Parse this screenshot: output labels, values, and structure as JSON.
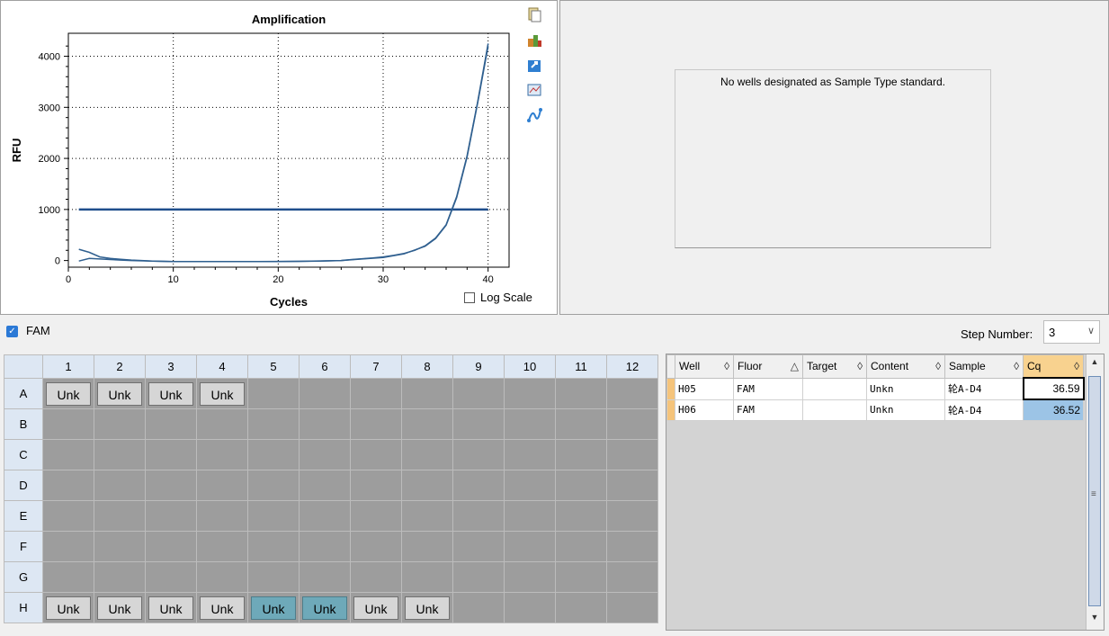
{
  "chart_data": {
    "type": "line",
    "title": "Amplification",
    "xlabel": "Cycles",
    "ylabel": "RFU",
    "xlim": [
      0,
      42
    ],
    "ylim": [
      -130,
      4450
    ],
    "xticks": [
      0,
      10,
      20,
      30,
      40
    ],
    "yticks": [
      0,
      1000,
      2000,
      3000,
      4000
    ],
    "grid": true,
    "threshold": 1000,
    "series": [
      {
        "values": [
          [
            1,
            220
          ],
          [
            2,
            160
          ],
          [
            3,
            70
          ],
          [
            4,
            40
          ],
          [
            5,
            25
          ],
          [
            6,
            10
          ],
          [
            7,
            0
          ],
          [
            8,
            -10
          ],
          [
            9,
            -15
          ],
          [
            10,
            -20
          ],
          [
            12,
            -20
          ],
          [
            14,
            -20
          ],
          [
            16,
            -20
          ],
          [
            18,
            -20
          ],
          [
            20,
            -20
          ],
          [
            22,
            -15
          ],
          [
            24,
            -10
          ],
          [
            26,
            0
          ],
          [
            27,
            20
          ],
          [
            28,
            35
          ],
          [
            29,
            50
          ],
          [
            30,
            70
          ],
          [
            31,
            100
          ],
          [
            32,
            140
          ],
          [
            33,
            200
          ],
          [
            34,
            290
          ],
          [
            35,
            440
          ],
          [
            36,
            700
          ],
          [
            37,
            1250
          ],
          [
            38,
            2050
          ],
          [
            39,
            3100
          ],
          [
            40,
            4250
          ]
        ]
      },
      {
        "values": [
          [
            1,
            -10
          ],
          [
            2,
            40
          ],
          [
            3,
            30
          ],
          [
            4,
            20
          ],
          [
            5,
            10
          ],
          [
            6,
            0
          ],
          [
            8,
            -10
          ],
          [
            10,
            -20
          ],
          [
            14,
            -20
          ],
          [
            18,
            -20
          ],
          [
            22,
            -15
          ],
          [
            26,
            0
          ],
          [
            28,
            30
          ],
          [
            30,
            60
          ],
          [
            32,
            130
          ],
          [
            34,
            280
          ],
          [
            35,
            430
          ],
          [
            36,
            690
          ],
          [
            37,
            1230
          ],
          [
            38,
            2030
          ],
          [
            39,
            3080
          ],
          [
            40,
            4200
          ]
        ]
      }
    ]
  },
  "log_scale_label": "Log Scale",
  "standard_curve_message": "No wells designated as Sample Type standard.",
  "fluor_label": "FAM",
  "step_number_label": "Step Number:",
  "step_number_value": "3",
  "plate": {
    "columns": [
      "1",
      "2",
      "3",
      "4",
      "5",
      "6",
      "7",
      "8",
      "9",
      "10",
      "11",
      "12"
    ],
    "rows": [
      {
        "label": "A",
        "wells": [
          "Unk",
          "Unk",
          "Unk",
          "Unk",
          "",
          "",
          "",
          "",
          "",
          "",
          "",
          ""
        ]
      },
      {
        "label": "B",
        "wells": [
          "",
          "",
          "",
          "",
          "",
          "",
          "",
          "",
          "",
          "",
          "",
          ""
        ]
      },
      {
        "label": "C",
        "wells": [
          "",
          "",
          "",
          "",
          "",
          "",
          "",
          "",
          "",
          "",
          "",
          ""
        ]
      },
      {
        "label": "D",
        "wells": [
          "",
          "",
          "",
          "",
          "",
          "",
          "",
          "",
          "",
          "",
          "",
          ""
        ]
      },
      {
        "label": "E",
        "wells": [
          "",
          "",
          "",
          "",
          "",
          "",
          "",
          "",
          "",
          "",
          "",
          ""
        ]
      },
      {
        "label": "F",
        "wells": [
          "",
          "",
          "",
          "",
          "",
          "",
          "",
          "",
          "",
          "",
          "",
          ""
        ]
      },
      {
        "label": "G",
        "wells": [
          "",
          "",
          "",
          "",
          "",
          "",
          "",
          "",
          "",
          "",
          "",
          ""
        ]
      },
      {
        "label": "H",
        "wells": [
          "Unk",
          "Unk",
          "Unk",
          "Unk",
          "Unk",
          "Unk",
          "Unk",
          "Unk",
          "",
          "",
          "",
          ""
        ]
      }
    ],
    "selected_wells": [
      "H5",
      "H6"
    ]
  },
  "results": {
    "headers": [
      "Well",
      "Fluor",
      "Target",
      "Content",
      "Sample",
      "Cq"
    ],
    "rows": [
      {
        "well": "H05",
        "fluor": "FAM",
        "target": "",
        "content": "Unkn",
        "sample": "轮A-D4",
        "cq": "36.59"
      },
      {
        "well": "H06",
        "fluor": "FAM",
        "target": "",
        "content": "Unkn",
        "sample": "轮A-D4",
        "cq": "36.52"
      }
    ]
  },
  "colors": {
    "curve": "#2f5f8f",
    "threshold": "#1f4e8c",
    "selected_well": "#6ea9b9",
    "cq_header": "#f8d28f"
  }
}
